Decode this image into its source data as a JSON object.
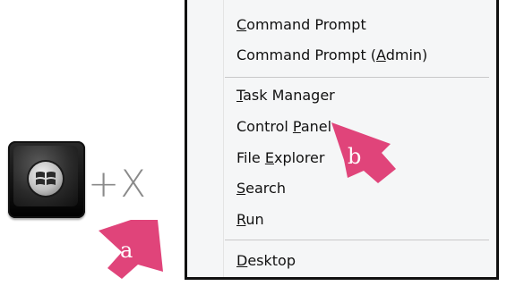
{
  "keyboard": {
    "key_icon": "windows-logo-key",
    "combo_text": "+X"
  },
  "callouts": {
    "a": {
      "label": "a",
      "color": "#e0447a"
    },
    "b": {
      "label": "b",
      "color": "#e0447a"
    }
  },
  "menu": {
    "items": [
      {
        "label": "Command Prompt",
        "underline": "C"
      },
      {
        "label": "Command Prompt (Admin)",
        "underline": "A"
      },
      {
        "label": "Task Manager",
        "underline": "T"
      },
      {
        "label": "Control Panel",
        "underline": "P"
      },
      {
        "label": "File Explorer",
        "underline": "E"
      },
      {
        "label": "Search",
        "underline": "S"
      },
      {
        "label": "Run",
        "underline": "R"
      },
      {
        "label": "Desktop",
        "underline": "D"
      }
    ]
  }
}
